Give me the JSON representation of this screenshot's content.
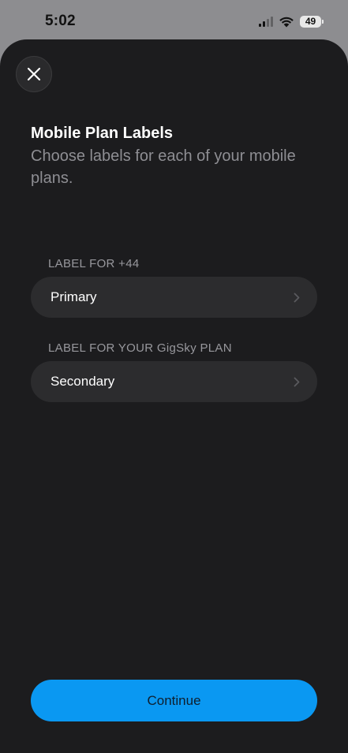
{
  "status_bar": {
    "time": "5:02",
    "battery": "49",
    "icons": [
      "signal-icon",
      "wifi-icon",
      "battery-icon"
    ]
  },
  "sheet": {
    "close_icon": "close-icon",
    "title": "Mobile Plan Labels",
    "subtitle": "Choose labels for each of your mobile plans."
  },
  "plans": [
    {
      "section_label": "LABEL FOR +44",
      "value": "Primary"
    },
    {
      "section_label": "LABEL FOR YOUR GigSky PLAN",
      "value": "Secondary"
    }
  ],
  "footer": {
    "continue_label": "Continue"
  },
  "colors": {
    "sheet_background": "#1c1c1e",
    "row_background": "#2c2c2e",
    "accent": "#0a98f2",
    "status_bar_background": "#8d8d90"
  }
}
